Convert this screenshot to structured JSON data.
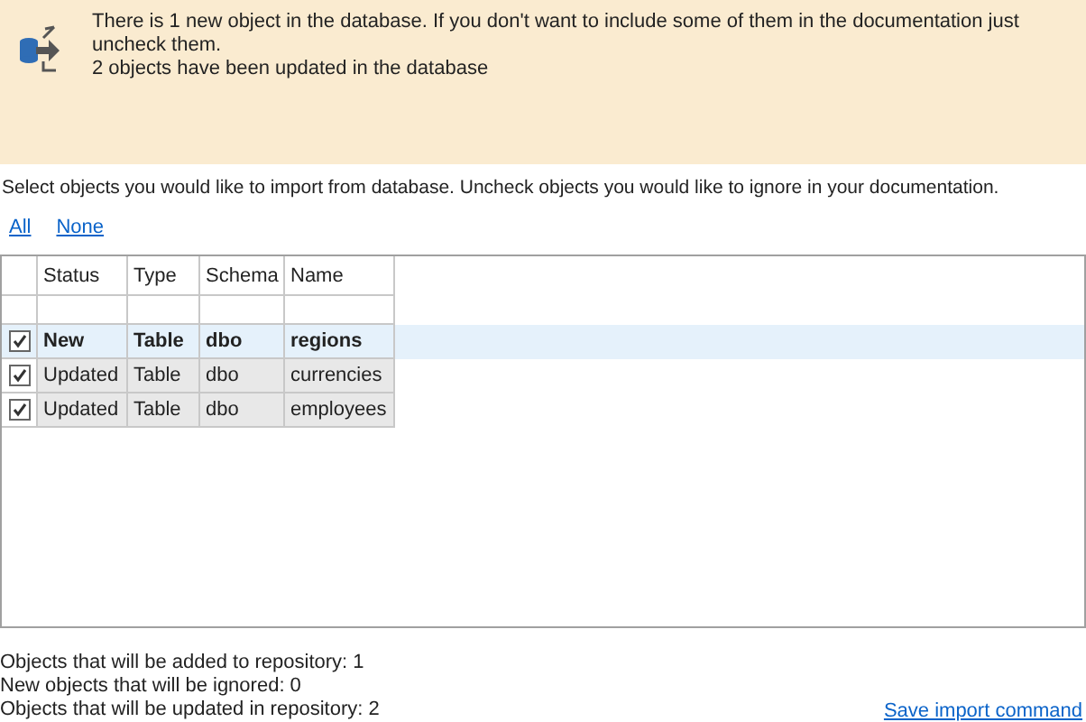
{
  "banner": {
    "lines": [
      "There is 1 new object in the database. If you don't want to include some of them in the documentation just uncheck them.",
      "2 objects have been updated in the database"
    ]
  },
  "instruction": "Select objects you would like to import from database. Uncheck objects you would like to ignore in your documentation.",
  "links": [
    "All",
    "None"
  ],
  "table": {
    "columns": [
      "Status",
      "Type",
      "Schema",
      "Name"
    ],
    "rows": [
      {
        "kind": "new",
        "checked": true,
        "selected": true,
        "cells": [
          "New",
          "Table",
          "dbo",
          "regions"
        ]
      },
      {
        "kind": "updated",
        "checked": true,
        "selected": false,
        "cells": [
          "Updated",
          "Table",
          "dbo",
          "currencies"
        ]
      },
      {
        "kind": "updated",
        "checked": true,
        "selected": false,
        "cells": [
          "Updated",
          "Table",
          "dbo",
          "employees"
        ]
      }
    ]
  },
  "summary": [
    "Objects that will be added to repository: 1",
    "New objects that will be ignored: 0",
    "Objects that will be updated in repository: 2"
  ],
  "save_link": "Save import command"
}
